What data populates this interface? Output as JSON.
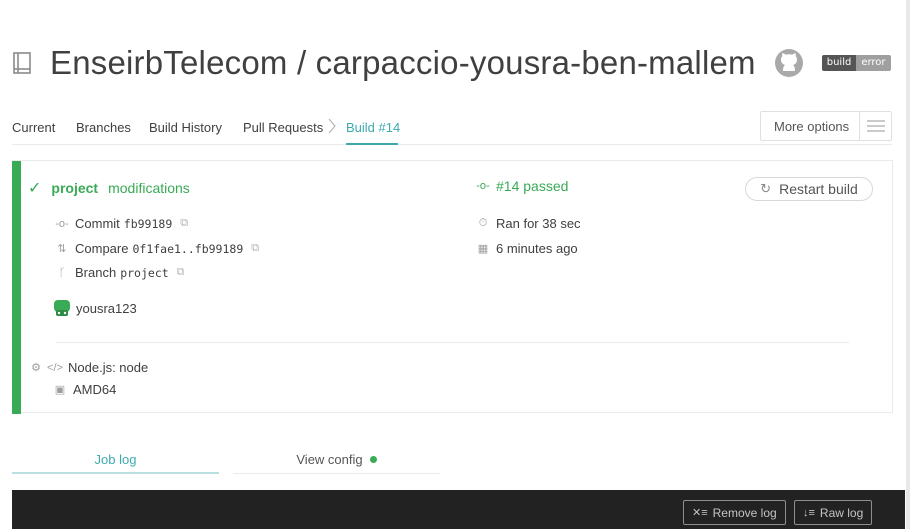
{
  "header": {
    "repo_title": "EnseirbTelecom / carpaccio-yousra-ben-mallem",
    "badge": {
      "left": "build",
      "right": "error"
    }
  },
  "tabs": {
    "current": "Current",
    "branches": "Branches",
    "build_history": "Build History",
    "pull_requests": "Pull Requests",
    "build": "Build #14",
    "more_options": "More options"
  },
  "build": {
    "branch": "project",
    "message": "modifications",
    "commit_label": "Commit",
    "commit_sha": "fb99189",
    "compare_label": "Compare",
    "compare_range": "0f1fae1..fb99189",
    "branch_label": "Branch",
    "branch_value": "project",
    "author": "yousra123",
    "status": "#14 passed",
    "duration": "Ran for 38 sec",
    "finished": "6 minutes ago",
    "restart": "Restart build",
    "language": "Node.js: node",
    "arch": "AMD64"
  },
  "log_tabs": {
    "job_log": "Job log",
    "view_config": "View config"
  },
  "log_actions": {
    "remove_log": "Remove log",
    "raw_log": "Raw log"
  },
  "colors": {
    "passed": "#39aa56",
    "accent": "#3eaaaf"
  }
}
